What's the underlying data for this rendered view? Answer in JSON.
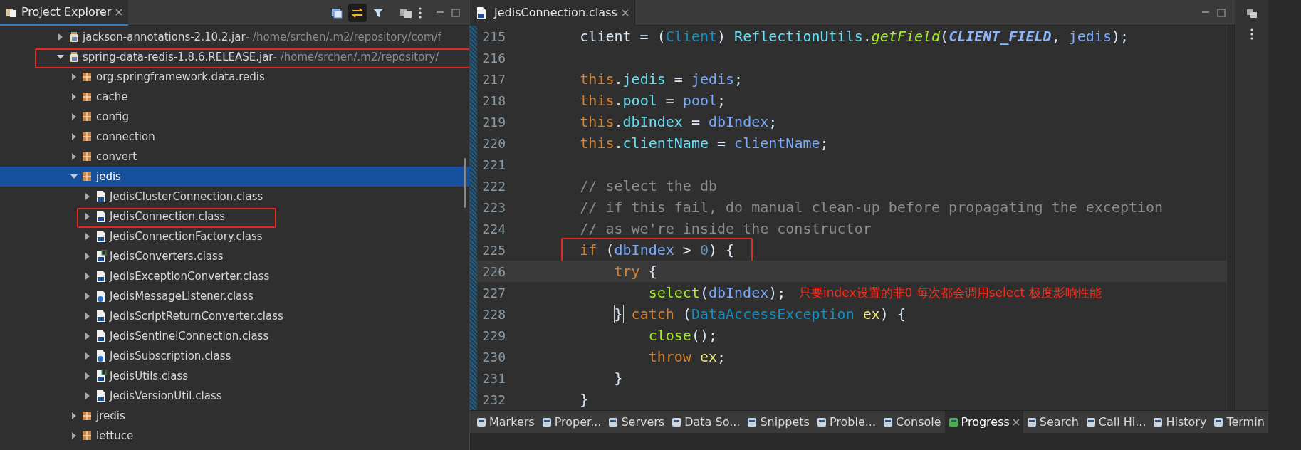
{
  "explorer": {
    "title": "Project Explorer",
    "link_editor": {
      "selected": true
    },
    "tree": [
      {
        "label": "jackson-annotations-2.10.2.jar",
        "path": " - /home/srchen/.m2/repository/com/f",
        "kind": "jar",
        "expanded": false,
        "selected": false,
        "boxed": false
      },
      {
        "label": "spring-data-redis-1.8.6.RELEASE.jar",
        "path": " - /home/srchen/.m2/repository/",
        "kind": "jar",
        "expanded": true,
        "selected": false,
        "boxed": true,
        "children": [
          {
            "label": "org.springframework.data.redis",
            "kind": "package",
            "expanded": false,
            "selected": false,
            "boxed": false
          },
          {
            "label": "cache",
            "kind": "package",
            "expanded": false,
            "selected": false,
            "boxed": false
          },
          {
            "label": "config",
            "kind": "package",
            "expanded": false,
            "selected": false,
            "boxed": false
          },
          {
            "label": "connection",
            "kind": "package",
            "expanded": false,
            "selected": false,
            "boxed": false
          },
          {
            "label": "convert",
            "kind": "package",
            "expanded": false,
            "selected": false,
            "boxed": false
          },
          {
            "label": "jedis",
            "kind": "package",
            "expanded": true,
            "selected": true,
            "boxed": false,
            "children": [
              {
                "label": "JedisClusterConnection.class",
                "kind": "class",
                "expanded": false,
                "selected": false,
                "boxed": false
              },
              {
                "label": "JedisConnection.class",
                "kind": "class",
                "expanded": false,
                "selected": false,
                "boxed": true
              },
              {
                "label": "JedisConnectionFactory.class",
                "kind": "class",
                "expanded": false,
                "selected": false,
                "boxed": false
              },
              {
                "label": "JedisConverters.class",
                "kind": "abstract",
                "expanded": false,
                "selected": false,
                "boxed": false
              },
              {
                "label": "JedisExceptionConverter.class",
                "kind": "class",
                "expanded": false,
                "selected": false,
                "boxed": false
              },
              {
                "label": "JedisMessageListener.class",
                "kind": "listener",
                "expanded": false,
                "selected": false,
                "boxed": false
              },
              {
                "label": "JedisScriptReturnConverter.class",
                "kind": "class",
                "expanded": false,
                "selected": false,
                "boxed": false
              },
              {
                "label": "JedisSentinelConnection.class",
                "kind": "class",
                "expanded": false,
                "selected": false,
                "boxed": false
              },
              {
                "label": "JedisSubscription.class",
                "kind": "listener",
                "expanded": false,
                "selected": false,
                "boxed": false
              },
              {
                "label": "JedisUtils.class",
                "kind": "abstract",
                "expanded": false,
                "selected": false,
                "boxed": false
              },
              {
                "label": "JedisVersionUtil.class",
                "kind": "class",
                "expanded": false,
                "selected": false,
                "boxed": false
              }
            ]
          },
          {
            "label": "jredis",
            "kind": "package",
            "expanded": false,
            "selected": false,
            "boxed": false
          },
          {
            "label": "lettuce",
            "kind": "package",
            "expanded": false,
            "selected": false,
            "boxed": false
          }
        ]
      }
    ]
  },
  "editor": {
    "tab": "JedisConnection.class",
    "lines": [
      {
        "number": "215",
        "current": false,
        "boxed": false,
        "tokens": [
          {
            "kind": "plain",
            "text": "        client = ("
          },
          {
            "kind": "type",
            "text": "Client"
          },
          {
            "kind": "plain",
            "text": ") "
          },
          {
            "kind": "field",
            "text": "ReflectionUtils"
          },
          {
            "kind": "plain",
            "text": "."
          },
          {
            "kind": "static",
            "text": "getField"
          },
          {
            "kind": "plain",
            "text": "("
          },
          {
            "kind": "constant",
            "text": "CLIENT_FIELD"
          },
          {
            "kind": "plain",
            "text": ", "
          },
          {
            "kind": "var",
            "text": "jedis"
          },
          {
            "kind": "plain",
            "text": ");"
          }
        ]
      },
      {
        "number": "216",
        "current": false
      },
      {
        "number": "217",
        "current": false,
        "boxed": false,
        "tokens": [
          {
            "kind": "keyword",
            "text": "        this"
          },
          {
            "kind": "plain",
            "text": "."
          },
          {
            "kind": "field",
            "text": "jedis"
          },
          {
            "kind": "plain",
            "text": " = "
          },
          {
            "kind": "var",
            "text": "jedis"
          },
          {
            "kind": "plain",
            "text": ";"
          }
        ]
      },
      {
        "number": "218",
        "current": false,
        "boxed": false,
        "tokens": [
          {
            "kind": "keyword",
            "text": "        this"
          },
          {
            "kind": "plain",
            "text": "."
          },
          {
            "kind": "field",
            "text": "pool"
          },
          {
            "kind": "plain",
            "text": " = "
          },
          {
            "kind": "var",
            "text": "pool"
          },
          {
            "kind": "plain",
            "text": ";"
          }
        ]
      },
      {
        "number": "219",
        "current": false,
        "boxed": false,
        "tokens": [
          {
            "kind": "keyword",
            "text": "        this"
          },
          {
            "kind": "plain",
            "text": "."
          },
          {
            "kind": "field",
            "text": "dbIndex"
          },
          {
            "kind": "plain",
            "text": " = "
          },
          {
            "kind": "var",
            "text": "dbIndex"
          },
          {
            "kind": "plain",
            "text": ";"
          }
        ]
      },
      {
        "number": "220",
        "current": false,
        "boxed": false,
        "tokens": [
          {
            "kind": "keyword",
            "text": "        this"
          },
          {
            "kind": "plain",
            "text": "."
          },
          {
            "kind": "field",
            "text": "clientName"
          },
          {
            "kind": "plain",
            "text": " = "
          },
          {
            "kind": "var",
            "text": "clientName"
          },
          {
            "kind": "plain",
            "text": ";"
          }
        ]
      },
      {
        "number": "221",
        "current": false
      },
      {
        "number": "222",
        "current": false,
        "boxed": false,
        "tokens": [
          {
            "kind": "comment",
            "text": "        // select the db"
          }
        ]
      },
      {
        "number": "223",
        "current": false,
        "boxed": false,
        "tokens": [
          {
            "kind": "comment",
            "text": "        // if this fail, do manual clean-up before propagating the exception"
          }
        ]
      },
      {
        "number": "224",
        "current": false,
        "boxed": false,
        "tokens": [
          {
            "kind": "comment",
            "text": "        // as we're inside the constructor"
          }
        ]
      },
      {
        "number": "225",
        "current": false,
        "boxed": true,
        "tokens": [
          {
            "kind": "keyword",
            "text": "        if"
          },
          {
            "kind": "plain",
            "text": " ("
          },
          {
            "kind": "var",
            "text": "dbIndex"
          },
          {
            "kind": "plain",
            "text": " > "
          },
          {
            "kind": "number",
            "text": "0"
          },
          {
            "kind": "plain",
            "text": ") {"
          }
        ]
      },
      {
        "number": "226",
        "current": true,
        "boxed": false,
        "tokens": [
          {
            "kind": "keyword",
            "text": "            try"
          },
          {
            "kind": "plain",
            "text": " {"
          }
        ]
      },
      {
        "number": "227",
        "current": false,
        "boxed": false,
        "note": "只要index设置的非0 每次都会调用select 极度影响性能",
        "tokens": [
          {
            "kind": "method",
            "text": "                select"
          },
          {
            "kind": "plain",
            "text": "("
          },
          {
            "kind": "var",
            "text": "dbIndex"
          },
          {
            "kind": "plain",
            "text": ");"
          }
        ]
      },
      {
        "number": "228",
        "current": false,
        "boxed": false,
        "tokens": [
          {
            "kind": "match",
            "text": "            }"
          },
          {
            "kind": "keyword",
            "text": " catch"
          },
          {
            "kind": "plain",
            "text": " ("
          },
          {
            "kind": "type",
            "text": "DataAccessException "
          },
          {
            "kind": "local",
            "text": "ex"
          },
          {
            "kind": "plain",
            "text": ") {"
          }
        ]
      },
      {
        "number": "229",
        "current": false,
        "boxed": false,
        "tokens": [
          {
            "kind": "method",
            "text": "                close"
          },
          {
            "kind": "plain",
            "text": "();"
          }
        ]
      },
      {
        "number": "230",
        "current": false,
        "boxed": false,
        "tokens": [
          {
            "kind": "keyword",
            "text": "                throw "
          },
          {
            "kind": "local",
            "text": "ex"
          },
          {
            "kind": "plain",
            "text": ";"
          }
        ]
      },
      {
        "number": "231",
        "current": false,
        "boxed": false,
        "tokens": [
          {
            "kind": "plain",
            "text": "            }"
          }
        ]
      },
      {
        "number": "232",
        "current": false,
        "boxed": false,
        "tokens": [
          {
            "kind": "plain",
            "text": "        }"
          }
        ]
      }
    ]
  },
  "bottom_tabs": [
    {
      "label": "Markers",
      "selected": false
    },
    {
      "label": "Proper...",
      "selected": false
    },
    {
      "label": "Servers",
      "selected": false
    },
    {
      "label": "Data So...",
      "selected": false
    },
    {
      "label": "Snippets",
      "selected": false
    },
    {
      "label": "Proble...",
      "selected": false
    },
    {
      "label": "Console",
      "selected": false
    },
    {
      "label": "Progress",
      "selected": true
    },
    {
      "label": "Search",
      "selected": false
    },
    {
      "label": "Call Hi...",
      "selected": false
    },
    {
      "label": "History",
      "selected": false
    },
    {
      "label": "Termin",
      "selected": false
    }
  ]
}
